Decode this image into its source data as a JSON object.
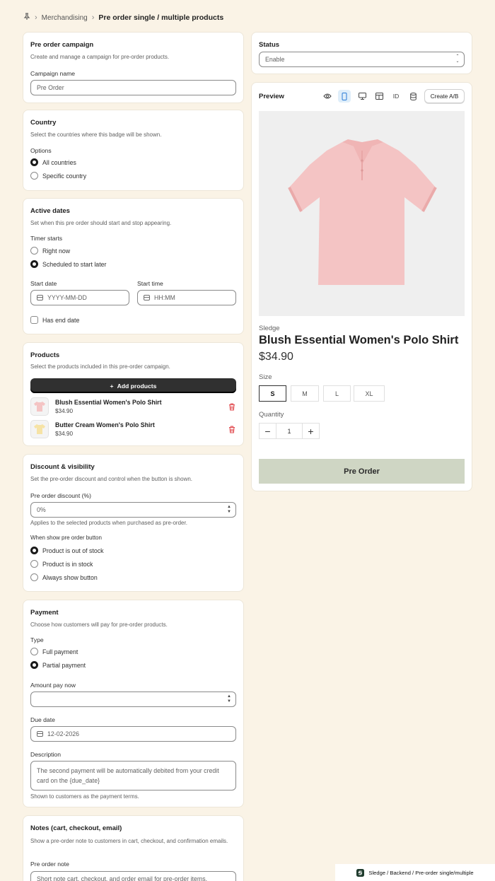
{
  "breadcrumb": {
    "parent": "Merchandising",
    "current": "Pre order single / multiple products"
  },
  "campaign": {
    "title": "Pre order campaign",
    "subtitle": "Create and manage a campaign for pre-order products.",
    "name_label": "Campaign name",
    "name_value": "Pre Order"
  },
  "country": {
    "title": "Country",
    "subtitle": "Select the countries where this badge will be shown.",
    "options_label": "Options",
    "options": [
      "All countries",
      "Specific country"
    ],
    "selected": "All countries"
  },
  "dates": {
    "title": "Active dates",
    "subtitle": "Set when this pre order should start and stop appearing.",
    "timer_label": "Timer starts",
    "timer_options": [
      "Right now",
      "Scheduled to start later"
    ],
    "start_date_label": "Start date",
    "start_date_placeholder": "YYYY-MM-DD",
    "start_time_label": "Start time",
    "start_time_placeholder": "HH:MM",
    "end_date_label": "Has end date"
  },
  "products": {
    "title": "Products",
    "subtitle": "Select the products included in this pre-order campaign.",
    "add_label": "Add products",
    "items": [
      {
        "name": "Blush Essential Women's Polo Shirt",
        "price": "$34.90",
        "color": "#f4c4c4"
      },
      {
        "name": "Butter Cream Women's Polo Shirt",
        "price": "$34.90",
        "color": "#f6e3a6"
      }
    ]
  },
  "discount": {
    "title": "Discount & visibility",
    "subtitle": "Set the pre-order discount and control when the button is shown.",
    "discount_label": "Pre order discount (%)",
    "discount_value": "0%",
    "discount_help": "Applies to the selected products when purchased as pre-order.",
    "show_label": "When show pre order button",
    "show_options": [
      "Product is out of stock",
      "Product is in stock",
      "Always show button"
    ]
  },
  "payment": {
    "title": "Payment",
    "subtitle": "Choose how customers will pay for pre-order products.",
    "type_label": "Type",
    "type_options": [
      "Full payment",
      "Partial payment"
    ],
    "amount_label": "Amount pay now",
    "due_label": "Due date",
    "due_value": "12-02-2026",
    "desc_label": "Description",
    "desc_value": "The second payment will be automatically debited from your credit card on the {due_date}",
    "desc_help": "Shown to customers as the payment terms."
  },
  "notes": {
    "title": "Notes (cart, checkout, email)",
    "subtitle": "Show a pre-order note to customers in cart, checkout, and confirmation emails.",
    "note_label": "Pre order note",
    "note_placeholder": "Short note cart, checkout, and order email for pre-order items."
  },
  "status": {
    "title": "Status",
    "value": "Enable"
  },
  "preview": {
    "title": "Preview",
    "id_label": "ID",
    "create_ab": "Create A/B",
    "vendor": "Sledge",
    "product_name": "Blush Essential Women's Polo Shirt",
    "price": "$34.90",
    "size_label": "Size",
    "sizes": [
      "S",
      "M",
      "L",
      "XL"
    ],
    "selected_size": "S",
    "quantity_label": "Quantity",
    "quantity": "1",
    "button_label": "Pre Order",
    "button_color": "#cfd6c4",
    "shirt_color": "#f4c4c4"
  },
  "footer": {
    "text": "Sledge / Backend / Pre-order single/multiple"
  }
}
